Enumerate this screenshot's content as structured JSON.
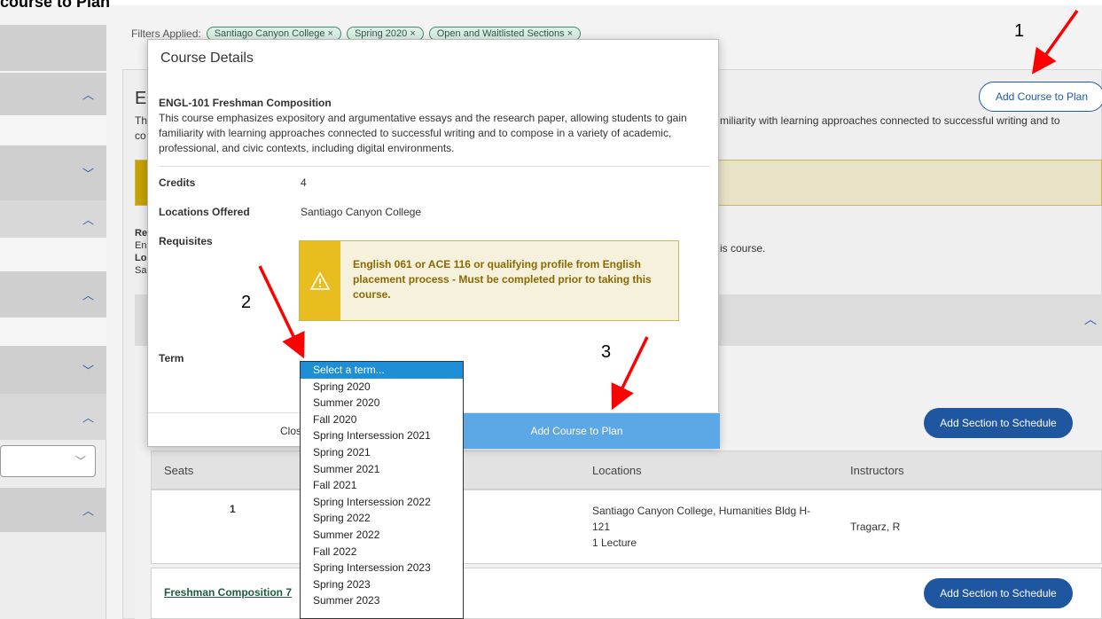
{
  "top_caption": "course to Plan",
  "filters": {
    "label": "Filters Applied:",
    "chips": [
      "Santiago Canyon College ×",
      "Spring 2020 ×",
      "Open and Waitlisted Sections ×"
    ]
  },
  "background": {
    "title": "EI",
    "desc_left": "Th",
    "desc_left2": "co",
    "desc_right": "miliarity with learning approaches connected to successful writing and to",
    "add_course_to_plan": "Add Course to Plan",
    "req_lines": [
      "Re",
      "En",
      "Lo",
      "Sa"
    ],
    "req_right": "is course.",
    "add_section_1": "Add Section to Schedule",
    "add_section_2": "Add Section to Schedule",
    "table_headers": {
      "seats": "Seats",
      "locations": "Locations",
      "instructors": "Instructors"
    },
    "row": {
      "seats": "1",
      "location_l1": "Santiago Canyon College, Humanities Bldg H-",
      "location_l2": "121",
      "location_l3": "1 Lecture",
      "instructor": "Tragarz, R"
    },
    "course_link": "Freshman Composition 7"
  },
  "modal": {
    "title": "Course Details",
    "course": "ENGL-101 Freshman Composition",
    "description": "This course emphasizes expository and argumentative essays and the research paper, allowing students to gain familiarity with learning approaches connected to successful writing and to compose in a variety of academic, professional, and civic contexts, including digital environments.",
    "credits_label": "Credits",
    "credits_value": "4",
    "locations_label": "Locations Offered",
    "locations_value": "Santiago Canyon College",
    "requisites_label": "Requisites",
    "requisite_text": "English 061 or ACE 116 or qualifying profile from English placement process - Must be completed prior to taking this course.",
    "term_label": "Term",
    "close_label": "Clos",
    "add_to_plan": "Add Course to Plan"
  },
  "term_options": [
    "Select a term...",
    "Spring 2020",
    "Summer 2020",
    "Fall 2020",
    "Spring Intersession 2021",
    "Spring 2021",
    "Summer 2021",
    "Fall 2021",
    "Spring Intersession 2022",
    "Spring 2022",
    "Summer 2022",
    "Fall 2022",
    "Spring Intersession 2023",
    "Spring 2023",
    "Summer 2023"
  ],
  "term_selected": "Select a term...",
  "annotations": {
    "n1": "1",
    "n2": "2",
    "n3": "3"
  },
  "colors": {
    "accent": "#1e56a0",
    "arrow": "#ff0000",
    "warning": "#e8bd1f",
    "selected_option": "#1e8fd6"
  }
}
